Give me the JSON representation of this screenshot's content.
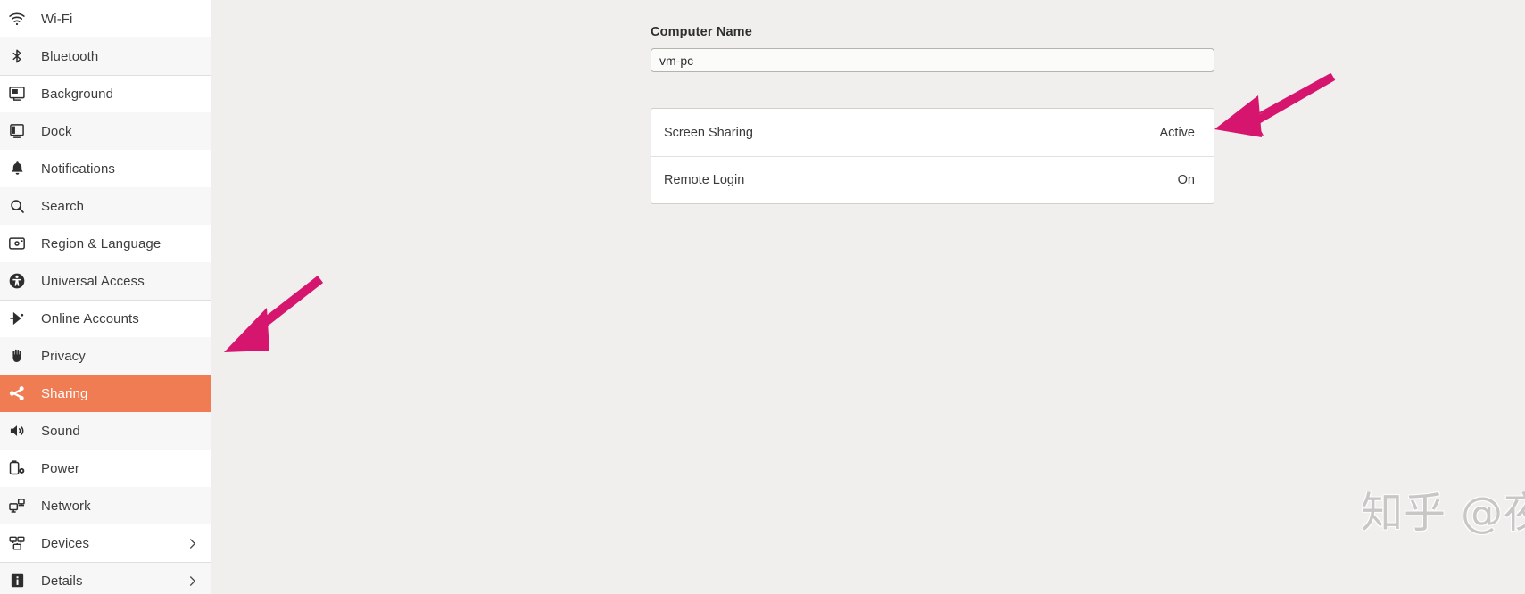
{
  "sidebar": {
    "items": [
      {
        "label": "Wi-Fi",
        "icon": "wifi-icon",
        "selected": false,
        "chevron": false,
        "separator_above": false
      },
      {
        "label": "Bluetooth",
        "icon": "bluetooth-icon",
        "selected": false,
        "chevron": false,
        "separator_above": false
      },
      {
        "label": "Background",
        "icon": "background-icon",
        "selected": false,
        "chevron": false,
        "separator_above": true
      },
      {
        "label": "Dock",
        "icon": "dock-icon",
        "selected": false,
        "chevron": false,
        "separator_above": false
      },
      {
        "label": "Notifications",
        "icon": "bell-icon",
        "selected": false,
        "chevron": false,
        "separator_above": false
      },
      {
        "label": "Search",
        "icon": "search-icon",
        "selected": false,
        "chevron": false,
        "separator_above": false
      },
      {
        "label": "Region & Language",
        "icon": "region-language-icon",
        "selected": false,
        "chevron": false,
        "separator_above": false
      },
      {
        "label": "Universal Access",
        "icon": "accessibility-icon",
        "selected": false,
        "chevron": false,
        "separator_above": false
      },
      {
        "label": "Online Accounts",
        "icon": "online-accounts-icon",
        "selected": false,
        "chevron": false,
        "separator_above": true
      },
      {
        "label": "Privacy",
        "icon": "privacy-hand-icon",
        "selected": false,
        "chevron": false,
        "separator_above": false
      },
      {
        "label": "Sharing",
        "icon": "sharing-icon",
        "selected": true,
        "chevron": false,
        "separator_above": false
      },
      {
        "label": "Sound",
        "icon": "sound-icon",
        "selected": false,
        "chevron": false,
        "separator_above": false
      },
      {
        "label": "Power",
        "icon": "power-battery-icon",
        "selected": false,
        "chevron": false,
        "separator_above": false
      },
      {
        "label": "Network",
        "icon": "network-icon",
        "selected": false,
        "chevron": false,
        "separator_above": false
      },
      {
        "label": "Devices",
        "icon": "devices-icon",
        "selected": false,
        "chevron": true,
        "separator_above": false
      },
      {
        "label": "Details",
        "icon": "details-info-icon",
        "selected": false,
        "chevron": true,
        "separator_above": true
      }
    ]
  },
  "main": {
    "computer_name_label": "Computer Name",
    "computer_name_value": "vm-pc",
    "computer_name_placeholder": "Computer Name",
    "rows": [
      {
        "label": "Screen Sharing",
        "value": "Active"
      },
      {
        "label": "Remote Login",
        "value": "On"
      }
    ]
  },
  "annotations": {
    "arrow_color": "#d6166e",
    "arrows": [
      {
        "name": "arrow-pointing-to-screen-sharing-status"
      },
      {
        "name": "arrow-pointing-to-sharing-sidebar-item"
      }
    ]
  },
  "watermark": {
    "text": "知乎 @夜行书生"
  },
  "colors": {
    "selected_item": "#ef7c53",
    "page_background": "#f0efee",
    "sidebar_background": "#ffffff",
    "card_background": "#ffffff"
  }
}
